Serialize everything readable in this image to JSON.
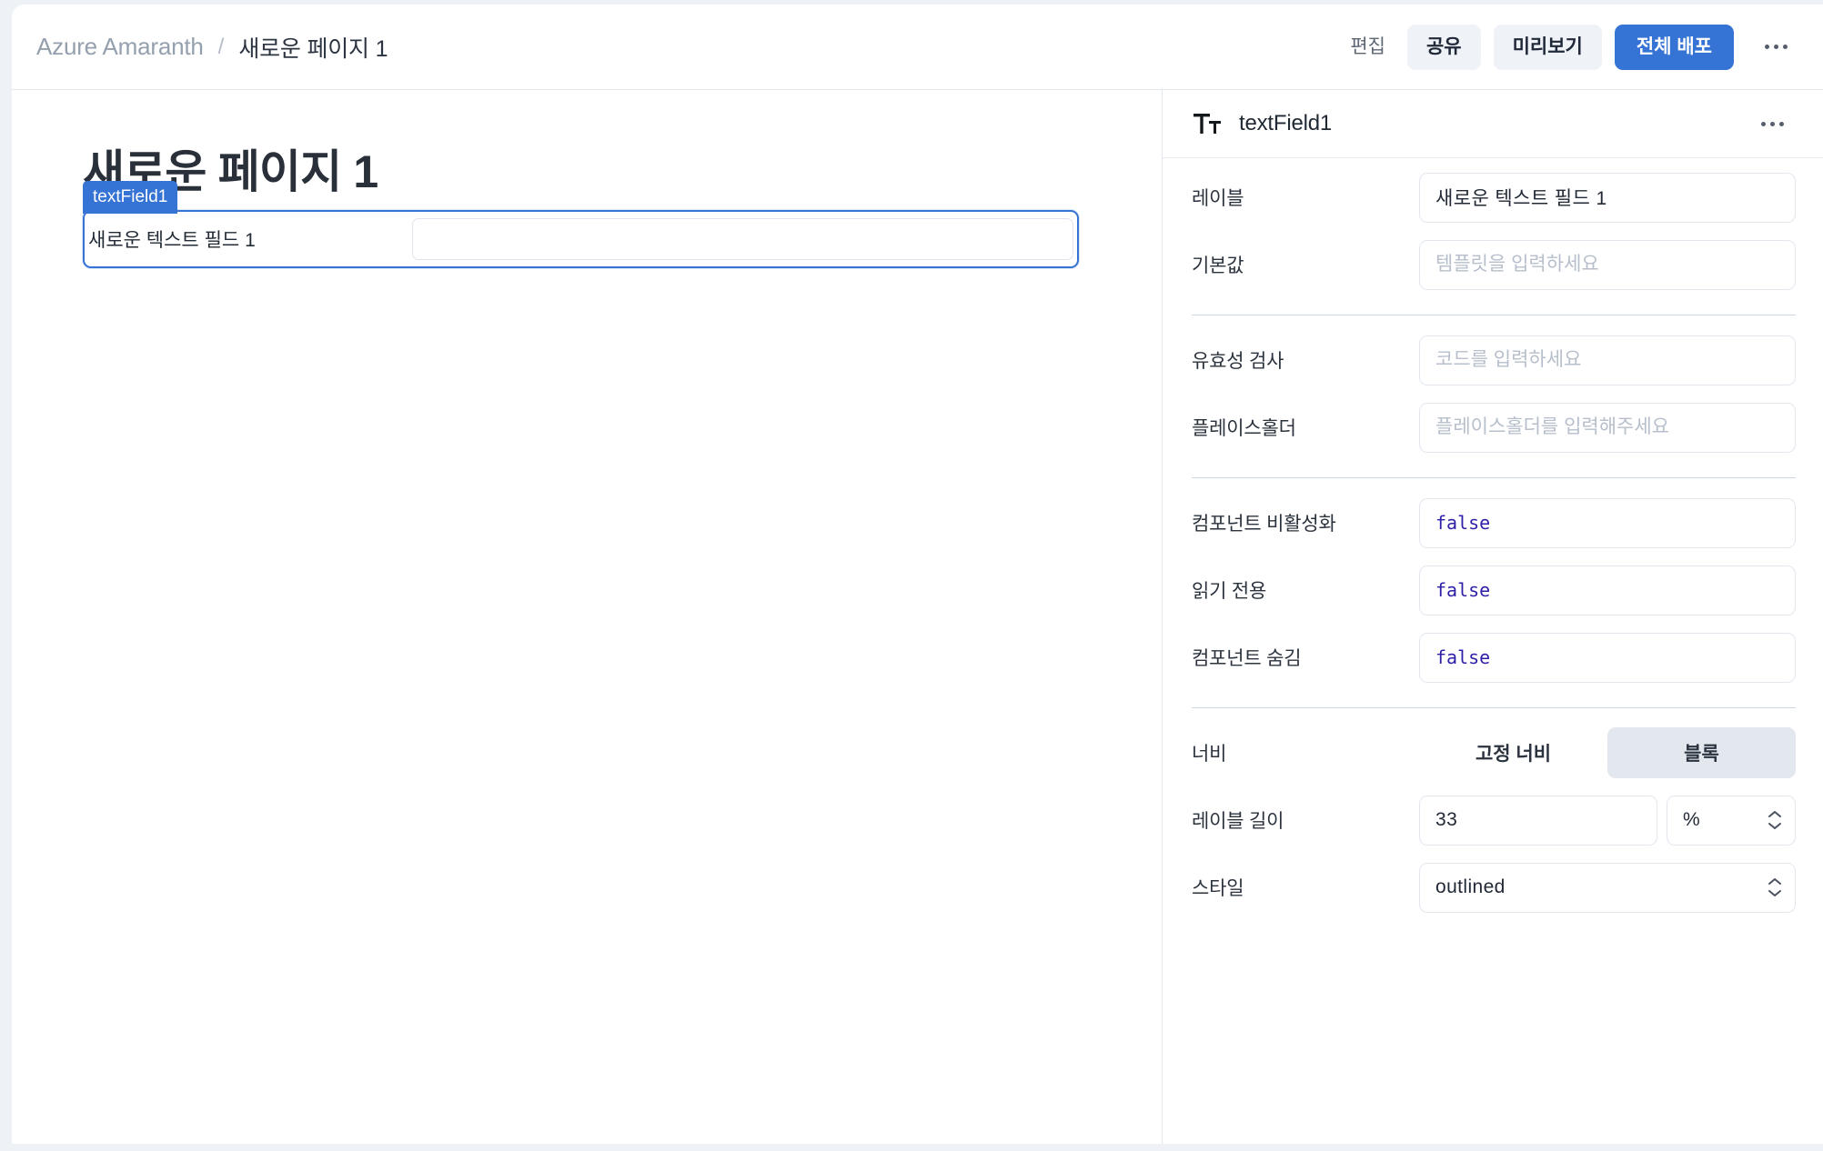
{
  "topbar": {
    "breadcrumb": {
      "app_name": "Azure Amaranth",
      "separator": "/",
      "page_name": "새로운 페이지 1"
    },
    "actions": {
      "edit_label": "편집",
      "share_label": "공유",
      "preview_label": "미리보기",
      "deploy_label": "전체 배포",
      "more_label": "···"
    },
    "colors": {
      "primary": "#3573d4",
      "soft_button_bg": "#eff2f6"
    }
  },
  "canvas": {
    "page_heading": "새로운 페이지 1",
    "selection_badge": "textField1",
    "component": {
      "label": "새로운 텍스트 필드 1",
      "input_value": "",
      "input_placeholder": ""
    }
  },
  "panel": {
    "icon_name": "text-format-icon",
    "title": "textField1",
    "more_label": "···",
    "groups": [
      {
        "rows": [
          {
            "label": "레이블",
            "kind": "text",
            "value": "새로운 텍스트 필드 1",
            "placeholder": ""
          },
          {
            "label": "기본값",
            "kind": "text",
            "value": "",
            "placeholder": "템플릿을 입력하세요"
          }
        ]
      },
      {
        "rows": [
          {
            "label": "유효성 검사",
            "kind": "text",
            "value": "",
            "placeholder": "코드를 입력하세요"
          },
          {
            "label": "플레이스홀더",
            "kind": "text",
            "value": "",
            "placeholder": "플레이스홀더를 입력해주세요"
          }
        ]
      },
      {
        "rows": [
          {
            "label": "컴포넌트 비활성화",
            "kind": "code",
            "value": "false",
            "placeholder": ""
          },
          {
            "label": "읽기 전용",
            "kind": "code",
            "value": "false",
            "placeholder": ""
          },
          {
            "label": "컴포넌트 숨김",
            "kind": "code",
            "value": "false",
            "placeholder": ""
          }
        ]
      }
    ],
    "width_row": {
      "label": "너비",
      "options": [
        {
          "label": "고정 너비",
          "selected": false
        },
        {
          "label": "블록",
          "selected": true
        }
      ]
    },
    "label_width_row": {
      "label": "레이블 길이",
      "value": "33",
      "unit": "%"
    },
    "style_row": {
      "label": "스타일",
      "value": "outlined"
    }
  }
}
